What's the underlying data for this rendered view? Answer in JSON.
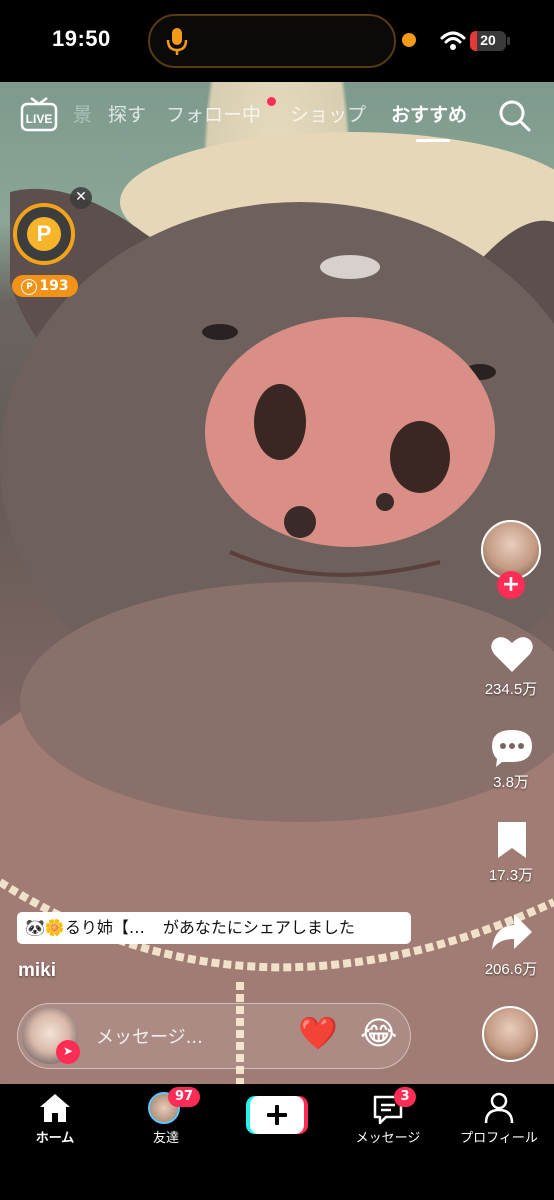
{
  "status_bar": {
    "time": "19:50",
    "battery": "20",
    "battery_level": 0.2
  },
  "top_nav": {
    "live_label": "LIVE",
    "tabs": [
      {
        "label": "探す"
      },
      {
        "label": "フォロー中"
      },
      {
        "label": "ショップ"
      },
      {
        "label": "おすすめ",
        "active": true
      }
    ],
    "partial_tab": "景"
  },
  "coin_widget": {
    "symbol": "P",
    "count": "193",
    "badge_symbol": "P"
  },
  "right_rail": {
    "like_count": "234.5万",
    "comment_count": "3.8万",
    "bookmark_count": "17.3万",
    "share_count": "206.6万"
  },
  "share_notice": {
    "sender": "🐼🌼るり姉【…",
    "message": "があなたにシェアしました"
  },
  "username": "miki",
  "message_bar": {
    "placeholder": "メッセージ...",
    "emoji_1": "❤️",
    "emoji_2": "😂"
  },
  "bottom_tabs": [
    {
      "label": "ホーム",
      "icon": "home-icon"
    },
    {
      "label": "友達",
      "icon": "friends-avatar",
      "badge": "97"
    },
    {
      "label": "",
      "icon": "plus-icon"
    },
    {
      "label": "メッセージ",
      "icon": "message-icon",
      "badge": "3"
    },
    {
      "label": "プロフィール",
      "icon": "profile-icon"
    }
  ],
  "colors": {
    "accent": "#ff2d55",
    "coin": "#f2a31b",
    "island_border": "#5a3a12"
  }
}
